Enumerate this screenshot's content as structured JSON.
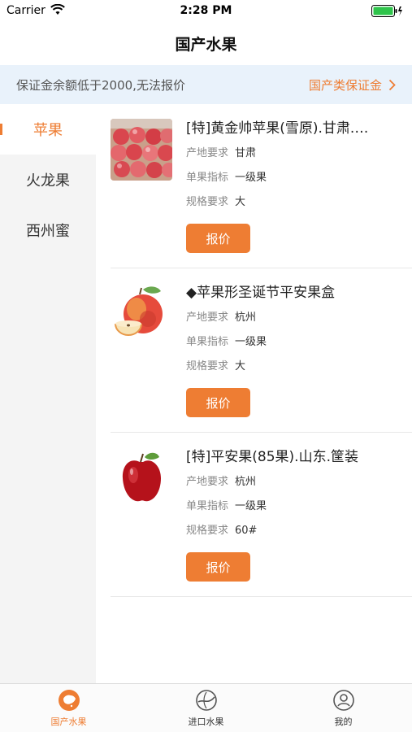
{
  "status": {
    "carrier": "Carrier",
    "time": "2:28 PM"
  },
  "nav": {
    "title": "国产水果"
  },
  "notice": {
    "text": "保证金余额低于2000,无法报价",
    "link": "国产类保证金"
  },
  "sidebar": {
    "items": [
      {
        "label": "苹果",
        "active": true
      },
      {
        "label": "火龙果",
        "active": false
      },
      {
        "label": "西州蜜",
        "active": false
      }
    ]
  },
  "labels": {
    "origin": "产地要求",
    "grade": "单果指标",
    "spec": "规格要求",
    "quote_button": "报价"
  },
  "products": [
    {
      "title": "[特]黄金帅苹果(雪原).甘肃.…",
      "origin": "甘肃",
      "grade": "一级果",
      "spec": "大",
      "image": "apple-crate-image"
    },
    {
      "title": "◆苹果形圣诞节平安果盒",
      "origin": "杭州",
      "grade": "一级果",
      "spec": "大",
      "image": "apple-slice-image"
    },
    {
      "title": "[特]平安果(85果).山东.筐装",
      "origin": "杭州",
      "grade": "一级果",
      "spec": "60#",
      "image": "red-apple-image"
    }
  ],
  "tabs": [
    {
      "label": "国产水果",
      "icon": "china-map-icon",
      "active": true
    },
    {
      "label": "进口水果",
      "icon": "globe-icon",
      "active": false
    },
    {
      "label": "我的",
      "icon": "user-icon",
      "active": false
    }
  ],
  "colors": {
    "accent": "#ee7d33",
    "notice_bg": "#e9f2fb",
    "sidebar_bg": "#f4f4f4"
  }
}
